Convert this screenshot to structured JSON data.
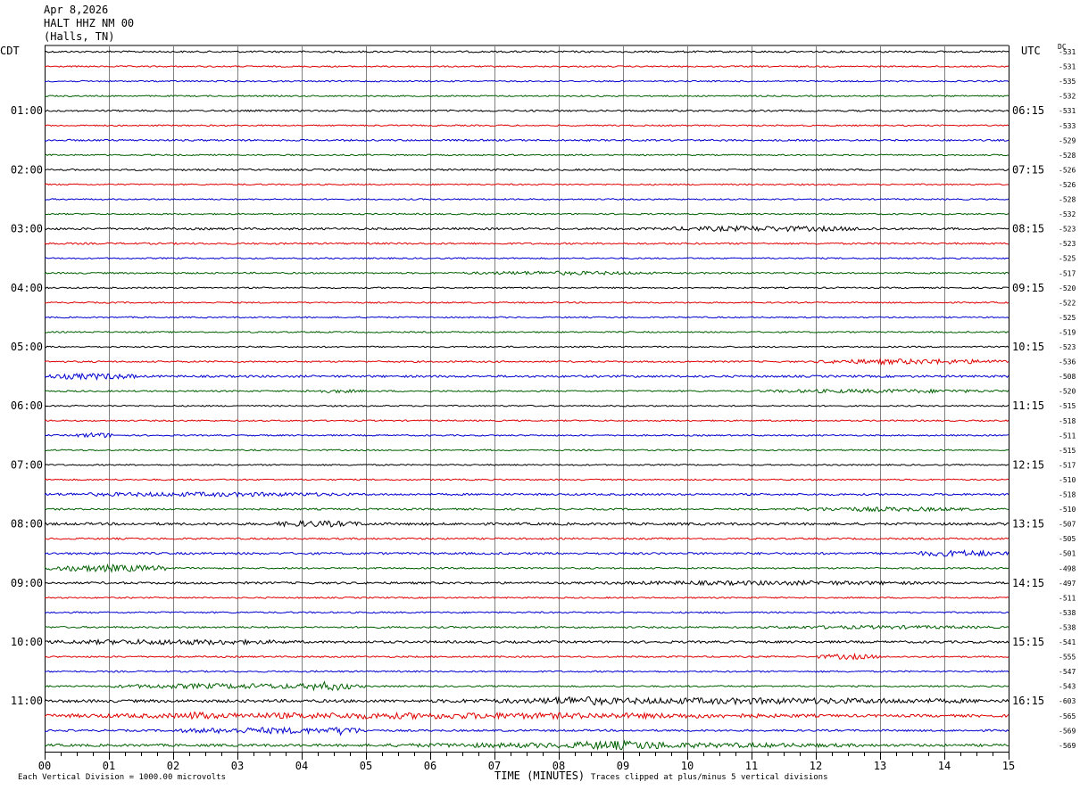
{
  "header": {
    "date": "Apr 8,2026",
    "station": "HALT HHZ NM 00",
    "location": "(Halls, TN)"
  },
  "left_zone": "CDT",
  "right_zone": "UTC",
  "dc_label": "DC",
  "footer": {
    "scale": "Each Vertical Division = 1000.00 microvolts",
    "xlabel": "TIME (MINUTES)",
    "clip_note": "Traces clipped at plus/minus 5 vertical divisions"
  },
  "colors": {
    "trace_cycle": [
      "#000000",
      "#e00000",
      "#0000d0",
      "#006000"
    ],
    "grid": "#808080"
  },
  "chart_data": {
    "type": "line",
    "title": "",
    "xlabel": "TIME (MINUTES)",
    "xlim": [
      0,
      15
    ],
    "x_ticks": [
      "00",
      "01",
      "02",
      "03",
      "04",
      "05",
      "06",
      "07",
      "08",
      "09",
      "10",
      "11",
      "12",
      "13",
      "14",
      "15"
    ],
    "trace_count": 48,
    "left_hour_labels": [
      "01:00",
      "02:00",
      "03:00",
      "04:00",
      "05:00",
      "06:00",
      "07:00",
      "08:00",
      "09:00",
      "10:00",
      "11:00"
    ],
    "right_hour_labels": [
      "06:15",
      "07:15",
      "08:15",
      "09:15",
      "10:15",
      "11:15",
      "12:15",
      "13:15",
      "14:15",
      "15:15",
      "16:15"
    ],
    "dc_offsets": [
      -531,
      -531,
      -535,
      -532,
      -531,
      -533,
      -529,
      -528,
      -526,
      -526,
      -528,
      -532,
      -523,
      -523,
      -525,
      -517,
      -520,
      -522,
      -525,
      -519,
      -523,
      -536,
      -508,
      -520,
      -515,
      -518,
      -511,
      -515,
      -517,
      -510,
      -518,
      -510,
      -507,
      -505,
      -501,
      -498,
      -497,
      -511,
      -538,
      -538,
      -541,
      -555,
      -547,
      -543,
      -603,
      -565,
      -569,
      -569
    ],
    "noise_amplitude": [
      1.0,
      0.8,
      0.8,
      0.8,
      1.0,
      0.8,
      1.0,
      0.8,
      1.0,
      0.8,
      0.8,
      0.8,
      1.2,
      1.0,
      0.8,
      0.9,
      0.8,
      0.8,
      0.8,
      0.8,
      0.8,
      0.9,
      1.2,
      0.9,
      0.8,
      0.8,
      0.8,
      0.8,
      0.8,
      0.8,
      1.1,
      1.0,
      1.4,
      1.0,
      1.2,
      0.9,
      1.2,
      0.8,
      0.9,
      1.0,
      1.3,
      0.9,
      0.9,
      0.9,
      1.6,
      1.5,
      1.1,
      1.4
    ],
    "bursts": [
      {
        "trace": 12,
        "x": [
          9.5,
          13.0
        ],
        "amp": 3.0
      },
      {
        "trace": 15,
        "x": [
          6.5,
          9.5
        ],
        "amp": 2.2
      },
      {
        "trace": 21,
        "x": [
          12.0,
          15.0
        ],
        "amp": 3.0
      },
      {
        "trace": 22,
        "x": [
          0.0,
          1.5
        ],
        "amp": 3.5
      },
      {
        "trace": 23,
        "x": [
          4.0,
          5.0
        ],
        "amp": 2.0
      },
      {
        "trace": 23,
        "x": [
          11.0,
          15.0
        ],
        "amp": 2.2
      },
      {
        "trace": 26,
        "x": [
          0.5,
          1.1
        ],
        "amp": 3.0
      },
      {
        "trace": 30,
        "x": [
          0.0,
          5.0
        ],
        "amp": 2.5
      },
      {
        "trace": 31,
        "x": [
          11.5,
          14.5
        ],
        "amp": 2.5
      },
      {
        "trace": 32,
        "x": [
          3.5,
          5.0
        ],
        "amp": 3.5
      },
      {
        "trace": 34,
        "x": [
          13.5,
          15.0
        ],
        "amp": 3.5
      },
      {
        "trace": 35,
        "x": [
          0.0,
          2.0
        ],
        "amp": 4.0
      },
      {
        "trace": 36,
        "x": [
          8.5,
          14.0
        ],
        "amp": 2.5
      },
      {
        "trace": 39,
        "x": [
          11.0,
          15.0
        ],
        "amp": 2.0
      },
      {
        "trace": 40,
        "x": [
          0.0,
          4.0
        ],
        "amp": 3.0
      },
      {
        "trace": 41,
        "x": [
          12.0,
          13.0
        ],
        "amp": 3.0
      },
      {
        "trace": 43,
        "x": [
          1.0,
          5.0
        ],
        "amp": 3.0
      },
      {
        "trace": 43,
        "x": [
          4.0,
          4.8
        ],
        "amp": 5.0
      },
      {
        "trace": 44,
        "x": [
          6.0,
          15.0
        ],
        "amp": 3.5
      },
      {
        "trace": 44,
        "x": [
          7.6,
          9.0
        ],
        "amp": 5.0
      },
      {
        "trace": 45,
        "x": [
          0.0,
          12.0
        ],
        "amp": 3.5
      },
      {
        "trace": 45,
        "x": [
          2.2,
          2.6
        ],
        "amp": 5.0
      },
      {
        "trace": 46,
        "x": [
          2.0,
          5.0
        ],
        "amp": 3.5
      },
      {
        "trace": 46,
        "x": [
          4.4,
          4.9
        ],
        "amp": 5.0
      },
      {
        "trace": 47,
        "x": [
          5.0,
          13.0
        ],
        "amp": 3.0
      },
      {
        "trace": 47,
        "x": [
          8.0,
          10.0
        ],
        "amp": 5.0
      }
    ]
  }
}
